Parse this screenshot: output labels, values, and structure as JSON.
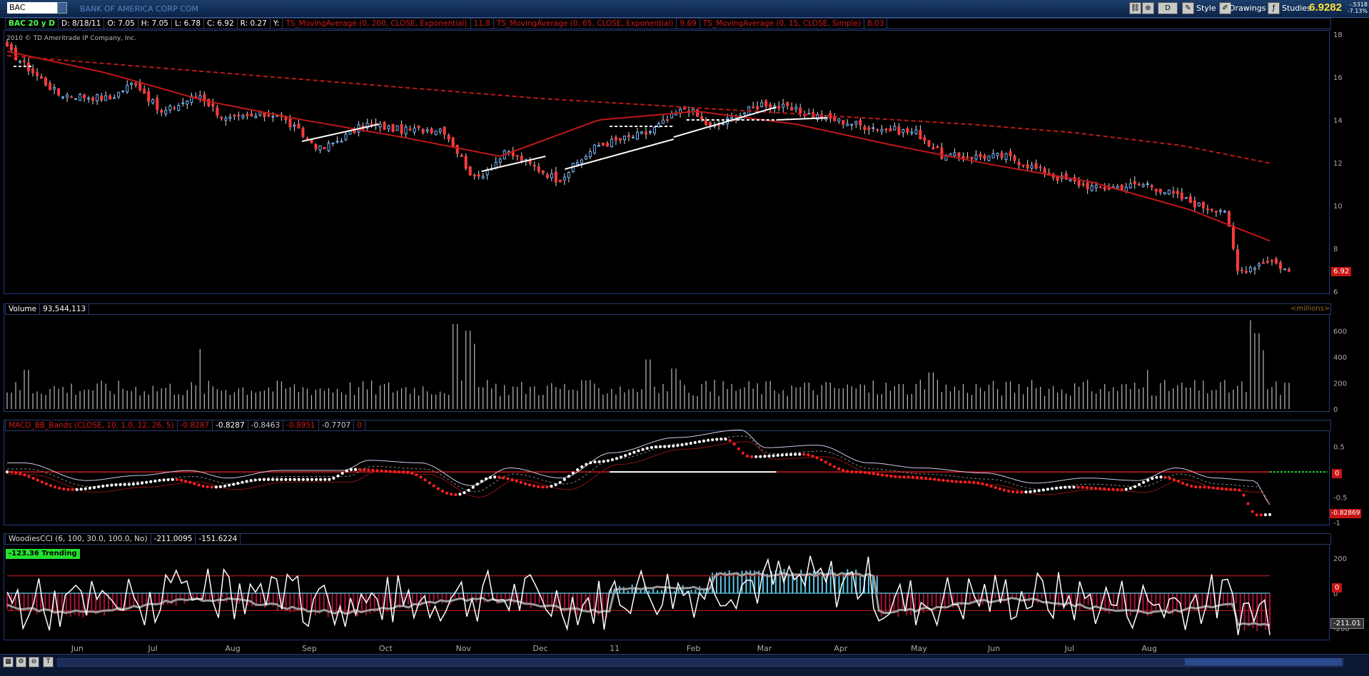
{
  "toolbar": {
    "symbol": "BAC",
    "company": "BANK OF AMERICA CORP COM",
    "style_label": "Style",
    "drawings_label": "Drawings",
    "studies_label": "Studies",
    "period_btn": "D",
    "last_price": "6.9282",
    "change_abs": "-.5318",
    "change_pct": "-7.13%"
  },
  "info": {
    "title": "BAC 20 y D",
    "date": "D: 8/18/11",
    "open": "O: 7.05",
    "high": "H: 7.05",
    "low": "L: 6.78",
    "close": "C: 6.92",
    "range": "R: 0.27",
    "y": "Y:",
    "ma200": "TS_MovingAverage (0, 200, CLOSE, Exponential)",
    "ma200_val": "11.8",
    "ma65": "TS_MovingAverage (0, 65, CLOSE, Exponential)",
    "ma65_val": "9.69",
    "ma15": "TS_MovingAverage (0, 15, CLOSE, Simple)",
    "ma15_val": "8.03",
    "copyright": "2010 © TD Ameritrade IP Company, Inc."
  },
  "volume_panel": {
    "label": "Volume",
    "value": "93,544,113",
    "units": "<millions>"
  },
  "macd_panel": {
    "label": "MACD_BB_Bands (CLOSE, 10, 1.0, 12, 26, 5)",
    "v1": "-0.8287",
    "v2": "-0.8287",
    "v3": "-0.8463",
    "v4": "-0.8951",
    "v5": "-0.7707",
    "v6": "0",
    "zero_label": "0",
    "last_label": "-0.82869"
  },
  "cci_panel": {
    "label": "WoodiesCCI (6, 100, 30.0, 100.0, No)",
    "v1": "-211.0095",
    "v2": "-151.6224",
    "trend_badge": "-123.36 Trending",
    "zero_label": "0",
    "last_label": "-211.01"
  },
  "x_axis": [
    "Jun",
    "Jul",
    "Aug",
    "Sep",
    "Oct",
    "Nov",
    "Dec",
    "11",
    "Feb",
    "Mar",
    "Apr",
    "May",
    "Jun",
    "Jul",
    "Aug"
  ],
  "colors": {
    "up": "#6fb7ff",
    "down": "#ff3a3a",
    "ma": "#c01818",
    "accent": "#ffe23a"
  },
  "chart_data": [
    {
      "type": "candlestick",
      "title": "BAC 20 y D",
      "ylim": [
        6,
        18
      ],
      "yticks": [
        6,
        8,
        10,
        12,
        14,
        16,
        18
      ],
      "last_price_label": "6.92",
      "anchors": [
        {
          "x": 0,
          "y": 17.3
        },
        {
          "x": 0.04,
          "y": 15.2
        },
        {
          "x": 0.08,
          "y": 15.0
        },
        {
          "x": 0.1,
          "y": 15.8
        },
        {
          "x": 0.12,
          "y": 14.3
        },
        {
          "x": 0.15,
          "y": 15.2
        },
        {
          "x": 0.17,
          "y": 14.0
        },
        {
          "x": 0.21,
          "y": 14.3
        },
        {
          "x": 0.245,
          "y": 12.6
        },
        {
          "x": 0.28,
          "y": 13.8
        },
        {
          "x": 0.31,
          "y": 13.5
        },
        {
          "x": 0.34,
          "y": 13.6
        },
        {
          "x": 0.365,
          "y": 11.2
        },
        {
          "x": 0.39,
          "y": 12.5
        },
        {
          "x": 0.43,
          "y": 11.2
        },
        {
          "x": 0.46,
          "y": 12.8
        },
        {
          "x": 0.5,
          "y": 13.4
        },
        {
          "x": 0.53,
          "y": 14.6
        },
        {
          "x": 0.55,
          "y": 13.6
        },
        {
          "x": 0.59,
          "y": 14.8
        },
        {
          "x": 0.63,
          "y": 14.2
        },
        {
          "x": 0.67,
          "y": 13.7
        },
        {
          "x": 0.71,
          "y": 13.4
        },
        {
          "x": 0.73,
          "y": 12.3
        },
        {
          "x": 0.78,
          "y": 12.3
        },
        {
          "x": 0.82,
          "y": 11.3
        },
        {
          "x": 0.85,
          "y": 10.8
        },
        {
          "x": 0.89,
          "y": 11.0
        },
        {
          "x": 0.93,
          "y": 10.0
        },
        {
          "x": 0.95,
          "y": 9.8
        },
        {
          "x": 0.96,
          "y": 6.9
        },
        {
          "x": 0.985,
          "y": 7.5
        },
        {
          "x": 1,
          "y": 6.9
        }
      ],
      "ma200": [
        17.0,
        16.6,
        16.2,
        15.8,
        15.4,
        15.0,
        14.7,
        14.4,
        14.1,
        13.8,
        13.4,
        12.8,
        11.8
      ],
      "ma65": [
        17.2,
        16.2,
        14.9,
        14.0,
        13.2,
        12.3,
        14.0,
        14.4,
        13.8,
        12.8,
        11.9,
        11.1,
        9.8,
        8.0
      ],
      "sma15": [
        {
          "range": [
            0.23,
            0.29
          ],
          "y": [
            13.0,
            13.8
          ]
        },
        {
          "range": [
            0.37,
            0.42
          ],
          "y": [
            11.6,
            12.3
          ]
        },
        {
          "range": [
            0.435,
            0.52
          ],
          "y": [
            11.7,
            13.1
          ]
        },
        {
          "range": [
            0.52,
            0.6
          ],
          "y": [
            13.2,
            14.6
          ]
        },
        {
          "range": [
            0.6,
            0.64
          ],
          "y": [
            14.0,
            14.1
          ]
        }
      ]
    },
    {
      "type": "bar",
      "title": "Volume",
      "ylim": [
        0,
        700
      ],
      "yticks": [
        0,
        200,
        400,
        600
      ],
      "spikes": [
        {
          "x": 0.015,
          "v": 300
        },
        {
          "x": 0.15,
          "v": 460
        },
        {
          "x": 0.35,
          "v": 650
        },
        {
          "x": 0.36,
          "v": 600
        },
        {
          "x": 0.365,
          "v": 500
        },
        {
          "x": 0.5,
          "v": 380
        },
        {
          "x": 0.52,
          "v": 310
        },
        {
          "x": 0.72,
          "v": 280
        },
        {
          "x": 0.89,
          "v": 300
        },
        {
          "x": 0.97,
          "v": 680
        },
        {
          "x": 0.975,
          "v": 580
        },
        {
          "x": 0.98,
          "v": 450
        }
      ],
      "base": 180
    },
    {
      "type": "line",
      "title": "MACD_BB_Bands",
      "ylim": [
        -1.0,
        0.75
      ],
      "yticks": [
        -1,
        -0.5,
        0,
        0.5
      ],
      "series": [
        {
          "x": [
            0,
            0.05,
            0.09,
            0.13,
            0.16,
            0.2,
            0.25,
            0.27,
            0.31,
            0.35,
            0.38,
            0.42,
            0.46,
            0.51,
            0.56,
            0.58,
            0.62,
            0.66,
            0.7,
            0.75,
            0.79,
            0.83,
            0.87,
            0.9,
            0.93,
            0.96,
            0.975,
            1
          ],
          "y": [
            0.0,
            -0.35,
            -0.25,
            -0.15,
            -0.3,
            -0.15,
            -0.15,
            0.05,
            0.0,
            -0.45,
            -0.1,
            -0.3,
            0.2,
            0.5,
            0.65,
            0.3,
            0.35,
            0.0,
            -0.1,
            -0.2,
            -0.4,
            -0.3,
            -0.35,
            -0.1,
            -0.3,
            -0.35,
            -0.85,
            -0.83
          ]
        }
      ]
    },
    {
      "type": "line",
      "title": "WoodiesCCI",
      "ylim": [
        -250,
        250
      ],
      "yticks": [
        -200,
        0,
        200
      ],
      "levels": [
        100,
        -100
      ]
    }
  ]
}
